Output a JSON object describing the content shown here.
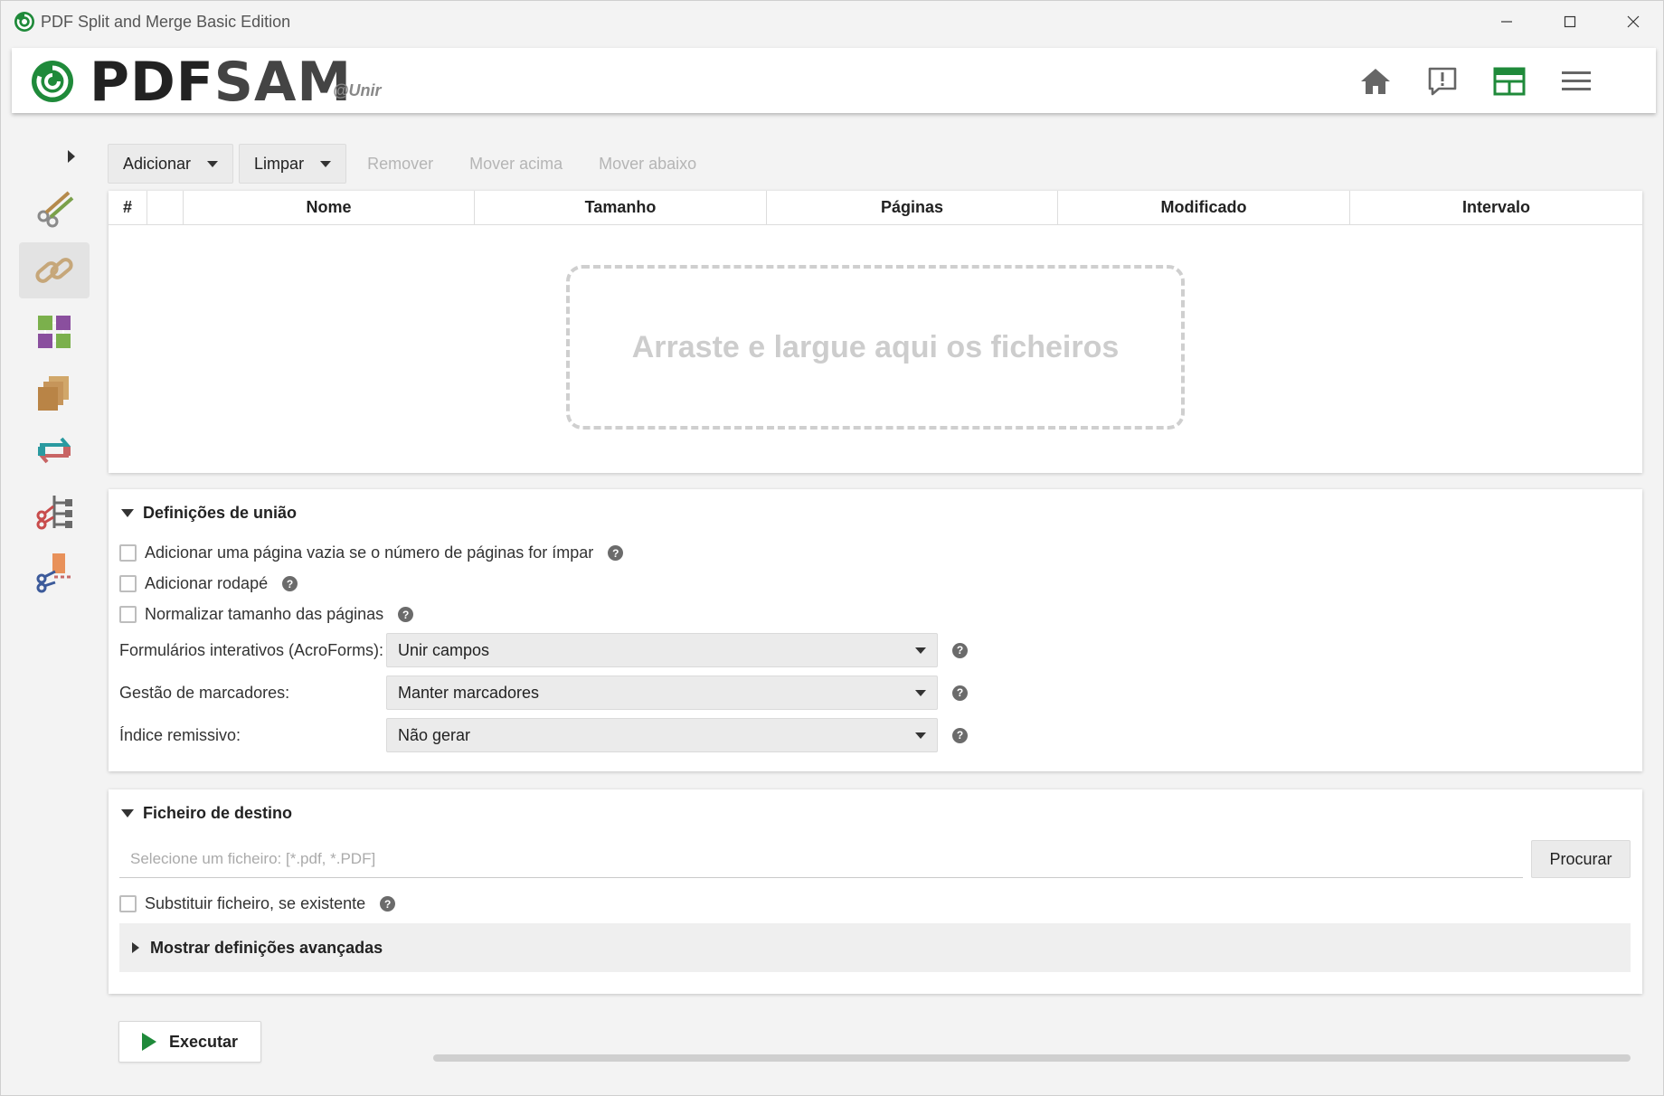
{
  "window": {
    "title": "PDF Split and Merge Basic Edition"
  },
  "header": {
    "brand_pdf": "PDF",
    "brand_sam": "SAM",
    "user": "@Unir",
    "accent": "#1f8a3a",
    "buttons": [
      "home-icon",
      "news-icon",
      "dashboard-icon",
      "menu-icon"
    ]
  },
  "sidebar": {
    "items": [
      {
        "name": "split",
        "icon": "scissors-icon"
      },
      {
        "name": "merge",
        "icon": "chain-icon",
        "active": true
      },
      {
        "name": "alternate-mix",
        "icon": "puzzle-icon"
      },
      {
        "name": "extract",
        "icon": "pages-icon"
      },
      {
        "name": "rotate",
        "icon": "rotate-icon"
      },
      {
        "name": "split-by-bookmarks",
        "icon": "tree-scissors-icon"
      },
      {
        "name": "split-by-size",
        "icon": "size-scissors-icon"
      }
    ]
  },
  "toolbar": {
    "add": "Adicionar",
    "clear": "Limpar",
    "remove": "Remover",
    "move_up": "Mover acima",
    "move_down": "Mover abaixo"
  },
  "table": {
    "columns": [
      "#",
      "",
      "Nome",
      "Tamanho",
      "Páginas",
      "Modificado",
      "Intervalo"
    ],
    "drop_text": "Arraste e largue aqui os ficheiros"
  },
  "merge_settings": {
    "title": "Definições de união",
    "blank_page": "Adicionar uma página vazia se o número de páginas for ímpar",
    "footer": "Adicionar rodapé",
    "normalize": "Normalizar tamanho das páginas",
    "acroforms_label": "Formulários interativos (AcroForms):",
    "acroforms_value": "Unir campos",
    "bookmarks_label": "Gestão de marcadores:",
    "bookmarks_value": "Manter marcadores",
    "toc_label": "Índice remissivo:",
    "toc_value": "Não gerar"
  },
  "destination": {
    "title": "Ficheiro de destino",
    "placeholder": "Selecione um ficheiro: [*.pdf, *.PDF]",
    "browse": "Procurar",
    "overwrite": "Substituir ficheiro, se existente",
    "advanced": "Mostrar definições avançadas"
  },
  "run": {
    "label": "Executar"
  }
}
